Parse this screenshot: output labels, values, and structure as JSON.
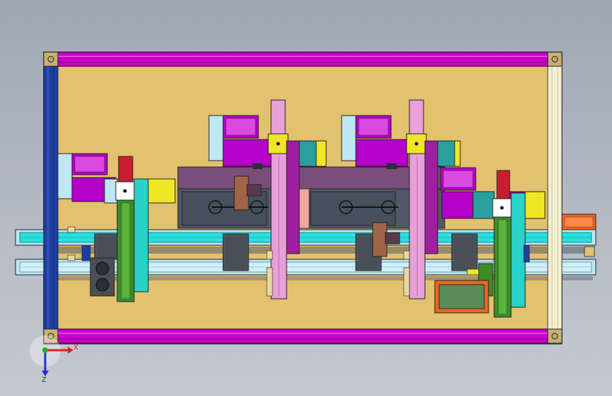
{
  "viewport": {
    "background_top": "#9fa7b3",
    "background_bottom": "#c4c9d1"
  },
  "colors": {
    "base_plate": "#e2c16f",
    "frame_magenta": "#c800c8",
    "frame_blue": "#1f3fa0",
    "frame_cream": "#f2efd2",
    "conveyor_cyan": "#28e0e0",
    "conveyor_light": "#bfe6f4",
    "motor_purple": "#b400c8",
    "module_green": "#3c8c28",
    "pad_yellow": "#f0e628",
    "pink": "#e8a0d8",
    "red": "#c81e32",
    "orange": "#f0641e",
    "dark_gray": "#4a4e56",
    "brown": "#a06446"
  },
  "triad": {
    "x_label": "X",
    "z_label": "Z",
    "x_color": "#e02020",
    "z_color": "#2030d0",
    "origin_color": "#20b020"
  }
}
